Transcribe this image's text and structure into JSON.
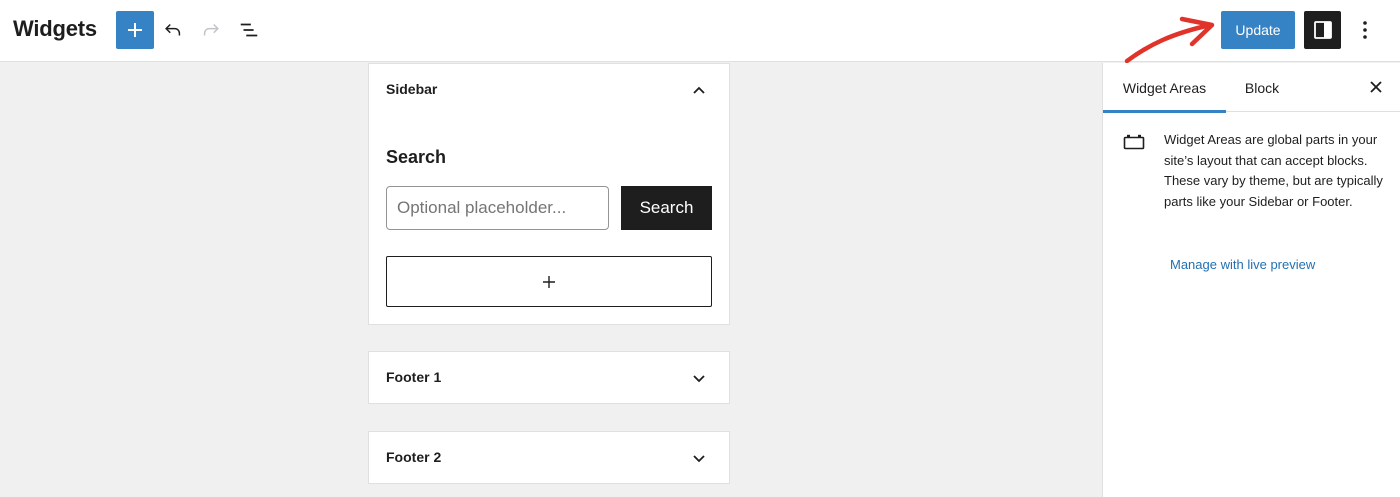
{
  "header": {
    "title": "Widgets",
    "add_icon": "plus-icon",
    "undo_icon": "undo-icon",
    "redo_icon": "redo-icon",
    "list_view_icon": "list-view-icon",
    "update_label": "Update",
    "settings_icon": "sidebar-toggle-icon",
    "more_icon": "more-vertical-icon",
    "accent_color": "#3582c4"
  },
  "widget_areas": {
    "sidebar": {
      "title": "Sidebar",
      "expanded": true,
      "search_block": {
        "label": "Search",
        "placeholder": "Optional placeholder...",
        "button_label": "Search"
      }
    },
    "footer1": {
      "title": "Footer 1",
      "expanded": false
    },
    "footer2": {
      "title": "Footer 2",
      "expanded": false
    }
  },
  "settings_sidebar": {
    "tabs": [
      {
        "label": "Widget Areas",
        "active": true
      },
      {
        "label": "Block",
        "active": false
      }
    ],
    "description": "Widget Areas are global parts in your site’s layout that can accept blocks. These vary by theme, but are typically parts like your Sidebar or Footer.",
    "link_label": "Manage with live preview",
    "link_color": "#2271b1"
  }
}
